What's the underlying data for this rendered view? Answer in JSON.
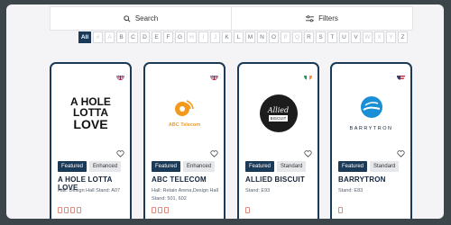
{
  "search": {
    "label": "Search",
    "icon": "search-icon"
  },
  "filters": {
    "label": "Filters",
    "icon": "filter-icon"
  },
  "alphabet": [
    "All",
    "#",
    "A",
    "B",
    "C",
    "D",
    "E",
    "F",
    "G",
    "H",
    "I",
    "J",
    "K",
    "L",
    "M",
    "N",
    "O",
    "P",
    "Q",
    "R",
    "S",
    "T",
    "U",
    "V",
    "W",
    "X",
    "Y",
    "Z"
  ],
  "alphabet_disabled": [
    "#",
    "A",
    "H",
    "I",
    "J",
    "P",
    "Q",
    "W",
    "X",
    "Y"
  ],
  "cards": [
    {
      "flag": "uk-flag-icon",
      "logo_lines": [
        "A HOLE",
        "LOTTA",
        "LOVE"
      ],
      "featured": "Featured",
      "tier": "Enhanced",
      "name": "A HOLE LOTTA LOVE",
      "info": "Hall: Design Hall Stand: A07"
    },
    {
      "flag": "uk-flag-icon",
      "logo_text": "ABC Telecom",
      "featured": "Featured",
      "tier": "Enhanced",
      "name": "ABC TELECOM",
      "info": "Hall: Retain Arena,Design Hall Stand: 501, 602"
    },
    {
      "flag": "ireland-flag-icon",
      "logo_text": "Allied",
      "logo_sub": "BISCUIT",
      "featured": "Featured",
      "tier": "Standard",
      "name": "ALLIED BISCUIT",
      "info": "Stand: E93"
    },
    {
      "flag": "usa-flag-icon",
      "logo_text": "BARRYTRON",
      "featured": "Featured",
      "tier": "Standard",
      "name": "BARRYTRON",
      "info": "Stand: E83"
    }
  ],
  "colors": {
    "navy": "#1b3a57",
    "accent_orange": "#f39a1e",
    "barrytron_blue": "#1a8fd6"
  }
}
